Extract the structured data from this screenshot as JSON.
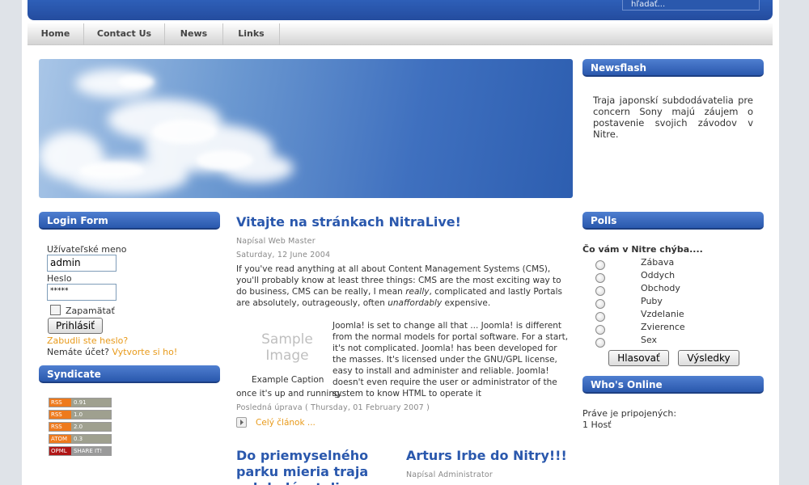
{
  "search": {
    "value": "hľadať..."
  },
  "nav": {
    "tabs": [
      "Home",
      "Contact Us",
      "News",
      "Links"
    ]
  },
  "newsflash": {
    "title": "Newsflash",
    "text": "Traja japonskí subdodávatelia pre concern Sony majú záujem o postavenie svojich závodov v Nitre."
  },
  "login": {
    "title": "Login Form",
    "username_label": "Užívateľské meno",
    "username_value": "admin",
    "password_label": "Heslo",
    "password_value": "*****",
    "remember_label": "Zapamätať",
    "submit_label": "Prihlásiť",
    "forgot_label": "Zabudli ste heslo?",
    "no_account_label": "Nemáte účet?",
    "register_label": "Vytvorte si ho!"
  },
  "syndicate": {
    "title": "Syndicate",
    "badges": [
      {
        "left": "RSS",
        "right": "0.91"
      },
      {
        "left": "RSS",
        "right": "1.0"
      },
      {
        "left": "RSS",
        "right": "2.0"
      },
      {
        "left": "ATOM",
        "right": "0.3"
      },
      {
        "left": "OPML",
        "right": "SHARE IT!"
      }
    ]
  },
  "main_article": {
    "title": "Vitajte na stránkach NitraLive!",
    "author": "Napísal Web Master",
    "date": "Saturday, 12 June 2004",
    "intro_1": "If you've read anything at all about Content Management Systems (CMS), you'll probably know at least three things: CMS are the most exciting way to do business, CMS can be really, I mean ",
    "intro_em1": "really",
    "intro_2": ", complicated and lastly Portals are absolutely, outrageously, often ",
    "intro_em2": "unaffordably",
    "intro_3": " expensive.",
    "image_text": "Sample Image",
    "caption": "Example Caption",
    "para_2a": "Joomla! is set to change all that ... Joomla! is different from the normal models for portal software. For a start, it's not complicated. Joomla! has been developed for the masses. It's licensed under the GNU/GPL license, easy to install and administer and reliable. Joomla! doesn't even require the user or administrator of the system to know HTML to operate it",
    "para_2b": "once it's up and running.",
    "modified": "Posledná úprava ( Thursday, 01 February 2007 )",
    "read_more": "Celý článok ..."
  },
  "article_2": {
    "title": "Do priemyselného parku mieria traja subdodávatelia"
  },
  "article_3": {
    "title": "Arturs Irbe do Nitry!!!",
    "author": "Napísal Administrator"
  },
  "polls": {
    "title": "Polls",
    "question": "Čo vám v Nitre chýba....",
    "options": [
      "Zábava",
      "Oddych",
      "Obchody",
      "Puby",
      "Vzdelanie",
      "Zvierence",
      "Sex"
    ],
    "vote_label": "Hlasovať",
    "results_label": "Výsledky"
  },
  "whos_online": {
    "title": "Who's Online",
    "line1": "Práve je pripojených:",
    "line2": "1 Hosť"
  },
  "colors": {
    "accent": "#2a58ad",
    "link": "#e89a1a"
  }
}
